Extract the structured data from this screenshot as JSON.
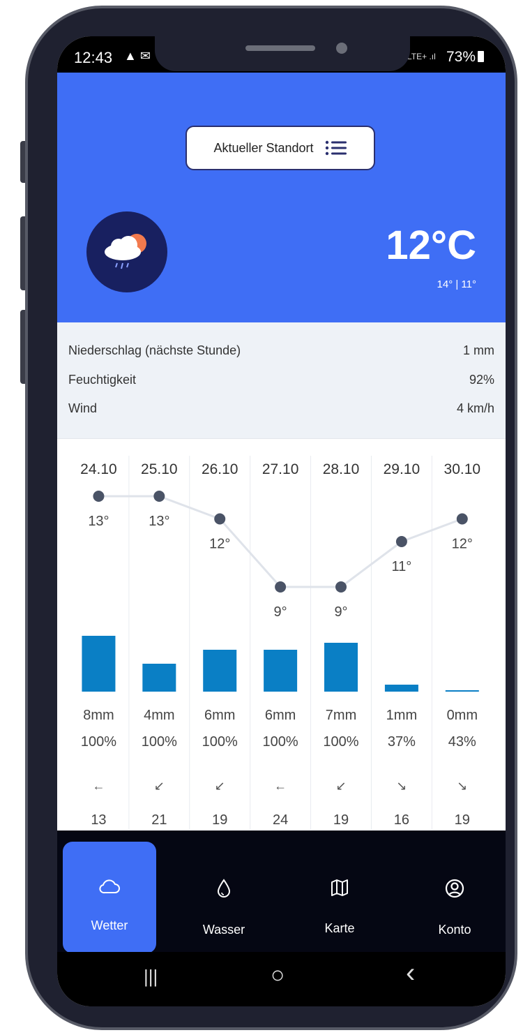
{
  "status_bar": {
    "time": "12:43",
    "left_icons": "▲ ✉",
    "network": "LTE+ .ıl",
    "battery": "73%"
  },
  "location": {
    "label": "Aktueller Standort",
    "icon": "list-icon"
  },
  "current": {
    "icon": "cloud-rain-sun-icon",
    "temperature": "12°C",
    "high_low": "14° | 11°"
  },
  "details": [
    {
      "label": "Niederschlag (nächste Stunde)",
      "value": "1 mm"
    },
    {
      "label": "Feuchtigkeit",
      "value": "92%"
    },
    {
      "label": "Wind",
      "value": "4 km/h"
    }
  ],
  "chart_data": {
    "type": "line",
    "categories": [
      "24.10",
      "25.10",
      "26.10",
      "27.10",
      "28.10",
      "29.10",
      "30.10"
    ],
    "series": [
      {
        "values": [
          13,
          13,
          12,
          9,
          9,
          11,
          12
        ]
      }
    ],
    "temp_labels": [
      "13°",
      "13°",
      "12°",
      "9°",
      "9°",
      "11°",
      "12°"
    ],
    "precip_mm": [
      8,
      4,
      6,
      6,
      7,
      1,
      0
    ],
    "precip_labels": [
      "8mm",
      "4mm",
      "6mm",
      "6mm",
      "7mm",
      "1mm",
      "0mm"
    ],
    "precip_prob": [
      "100%",
      "100%",
      "100%",
      "100%",
      "100%",
      "37%",
      "43%"
    ],
    "wind_arrows": [
      "←",
      "↙",
      "↙",
      "←",
      "↙",
      "↘",
      "↘"
    ],
    "wind_speed": [
      "13",
      "21",
      "19",
      "24",
      "19",
      "16",
      "19"
    ],
    "colors": {
      "line": "#dfe3ea",
      "point": "#4a5366",
      "bar": "#0a7fc5",
      "grid": "#e8ebf0"
    }
  },
  "nav": [
    {
      "label": "Wetter",
      "icon": "cloud-icon",
      "active": true
    },
    {
      "label": "Wasser",
      "icon": "drop-icon",
      "active": false
    },
    {
      "label": "Karte",
      "icon": "map-icon",
      "active": false
    },
    {
      "label": "Konto",
      "icon": "user-circle-icon",
      "active": false
    }
  ],
  "system_nav": {
    "recents": "|||",
    "home": "○",
    "back": "‹"
  },
  "colors": {
    "primary": "#3f6ef5",
    "dark_navy": "#182060",
    "nav_bg": "#050713"
  }
}
